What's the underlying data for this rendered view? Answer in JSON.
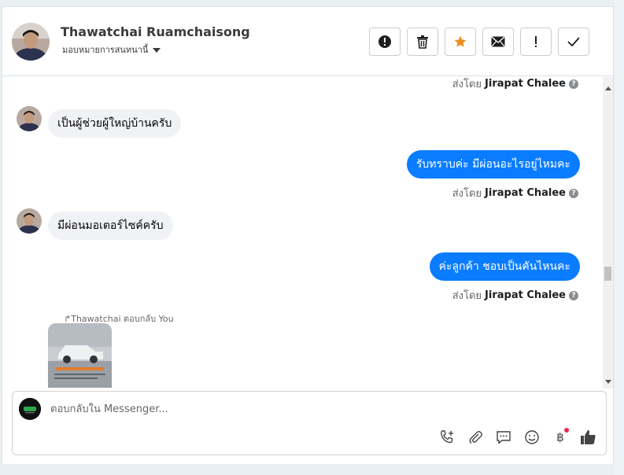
{
  "header": {
    "contact_name": "Thawatchai Ruamchaisong",
    "assign_label": "มอบหมายการสนทนานี้"
  },
  "toolbar": {
    "buttons": [
      {
        "icon": "alert-circle-icon"
      },
      {
        "icon": "trash-icon"
      },
      {
        "icon": "star-icon",
        "color": "#f28b1c"
      },
      {
        "icon": "envelope-icon"
      },
      {
        "icon": "exclamation-icon"
      },
      {
        "icon": "check-icon"
      }
    ]
  },
  "messages": {
    "sent_by_prefix": "ส่งโดย",
    "agent_name": "Jirapat Chalee",
    "items": [
      {
        "direction": "in",
        "text": "เป็นผู้ช่วยผู้ใหญ่บ้านครับ"
      },
      {
        "direction": "out",
        "text": "รับทราบค่ะ มีผ่อนอะไรอยู่ไหมคะ"
      },
      {
        "direction": "in",
        "text": "มีผ่อนมอเตอร์ไซค์ครับ"
      },
      {
        "direction": "out",
        "text": "ค่ะลูกค้า ชอบเป็นคันไหนคะ"
      }
    ],
    "reply_note": "Thawatchai ตอบกลับ You"
  },
  "composer": {
    "placeholder": "ตอบกลับใน Messenger...",
    "baht_symbol": "฿"
  },
  "colors": {
    "accent_blue": "#0a7cff",
    "incoming_bubble": "#f0f2f5",
    "star_orange": "#f28b1c",
    "like_blue": "#0a7cff",
    "notification_red": "#f02849"
  }
}
